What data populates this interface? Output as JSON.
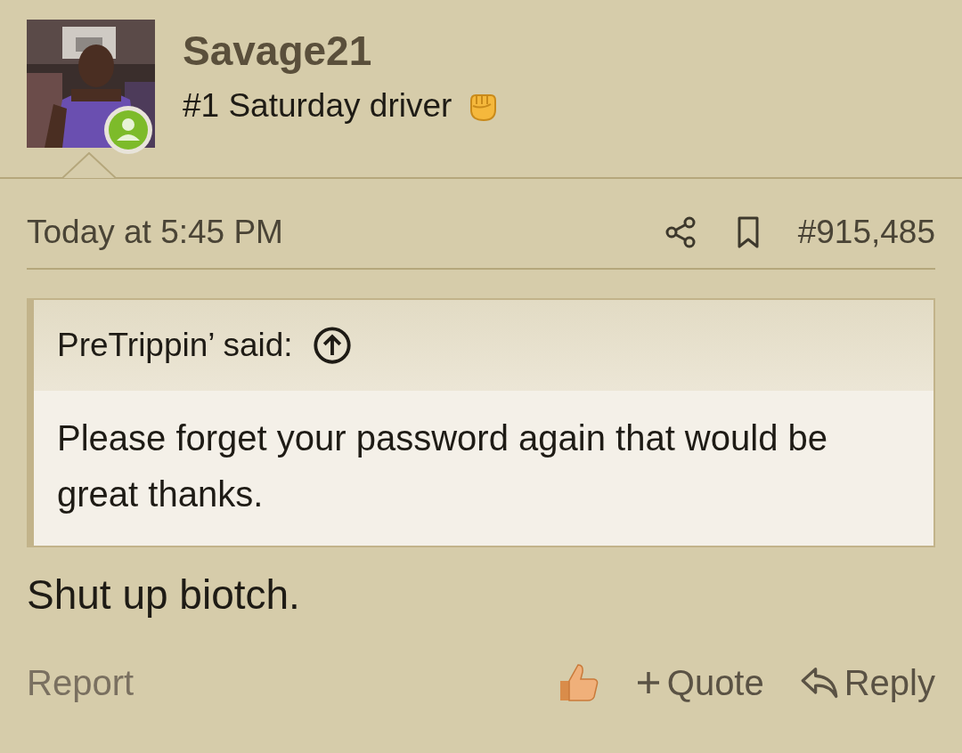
{
  "post": {
    "author": {
      "name": "Savage21",
      "title": "#1 Saturday driver",
      "online": true
    },
    "time": "Today at 5:45 PM",
    "post_number": "#915,485",
    "quote": {
      "author": "PreTrippin’ said:",
      "text": "Please forget your password again that would be great thanks."
    },
    "message": "Shut up biotch.",
    "actions": {
      "report": "Report",
      "quote": "Quote",
      "reply": "Reply"
    }
  }
}
